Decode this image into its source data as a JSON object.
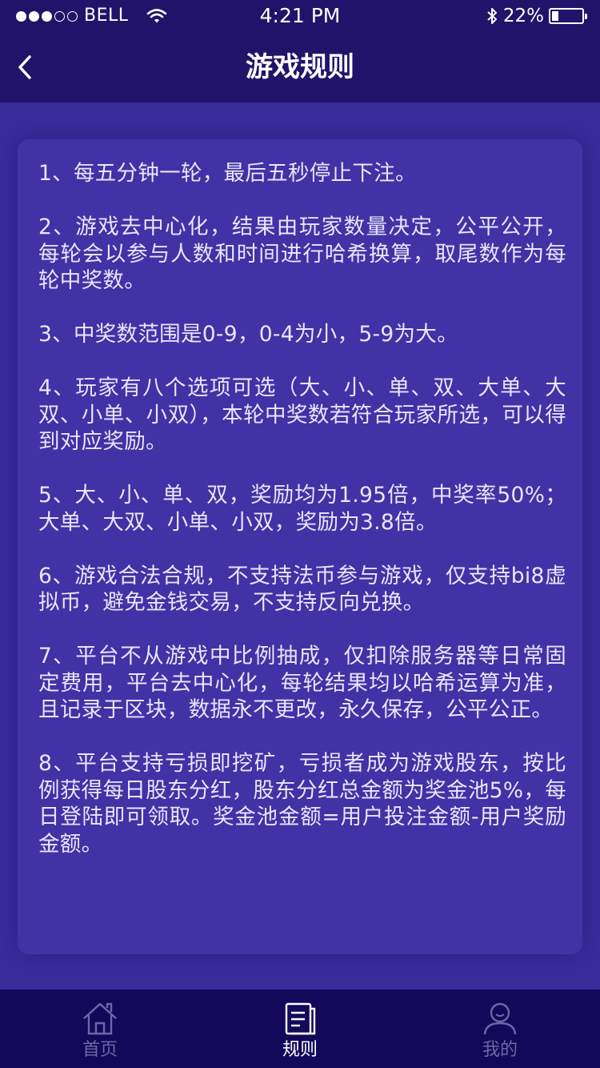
{
  "status_bar": {
    "carrier": "BELL",
    "time": "4:21 PM",
    "battery_percent": "22%",
    "battery_level": 0.22
  },
  "nav": {
    "title": "游戏规则",
    "back_icon": "chevron-left-icon"
  },
  "rules": [
    "1、每五分钟一轮，最后五秒停止下注。",
    "2、游戏去中心化，结果由玩家数量决定，公平公开，每轮会以参与人数和时间进行哈希换算，取尾数作为每轮中奖数。",
    "3、中奖数范围是0-9，0-4为小，5-9为大。",
    "4、玩家有八个选项可选（大、小、单、双、大单、大双、小单、小双），本轮中奖数若符合玩家所选，可以得到对应奖励。",
    "5、大、小、单、双，奖励均为1.95倍，中奖率50%；大单、大双、小单、小双，奖励为3.8倍。",
    "6、游戏合法合规，不支持法币参与游戏，仅支持bi8虚拟币，避免金钱交易，不支持反向兑换。",
    "7、平台不从游戏中比例抽成，仅扣除服务器等日常固定费用，平台去中心化，每轮结果均以哈希运算为准，且记录于区块，数据永不更改，永久保存，公平公正。",
    "8、平台支持亏损即挖矿，亏损者成为游戏股东，按比例获得每日股东分红，股东分红总金额为奖金池5%，每日登陆即可领取。奖金池金额=用户投注金额-用户奖励金额。"
  ],
  "tabs": [
    {
      "label": "首页",
      "icon": "home-icon",
      "active": false
    },
    {
      "label": "规则",
      "icon": "document-icon",
      "active": true
    },
    {
      "label": "我的",
      "icon": "user-icon",
      "active": false
    }
  ],
  "colors": {
    "background": "#3a2c9a",
    "header": "#22136a",
    "card": "#4132a6",
    "tabbar": "#13095a",
    "tab_inactive": "#6e66a8",
    "tab_active": "#ffffff"
  }
}
